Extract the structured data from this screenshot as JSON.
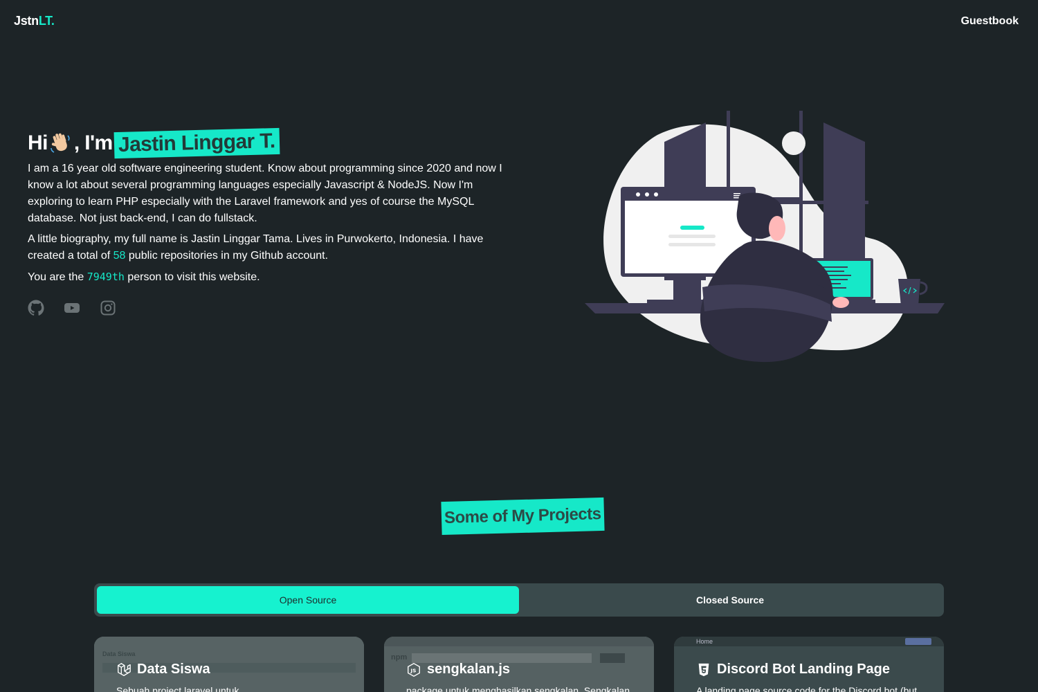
{
  "nav": {
    "logo_main": "Jstn",
    "logo_accent": "LT.",
    "guestbook": "Guestbook"
  },
  "hero": {
    "greeting_hi": "Hi",
    "greeting_im": ", I'm",
    "name": "Jastin Linggar T.",
    "para1": "I am a 16 year old software engineering student. Know about programming since 2020 and now I know a lot about several programming languages especially Javascript & NodeJS. Now I'm exploring to learn PHP especially with the Laravel framework and yes of course the MySQL database. Not just back-end, I can do fullstack.",
    "para2_before": "A little biography, my full name is Jastin Linggar Tama. Lives in Purwokerto, Indonesia. I have created a total of",
    "repo_count": "58",
    "para2_after": "public repositories in my Github account.",
    "visit_before": "You are the",
    "visit_count": "7949th",
    "visit_after": "person to visit this website."
  },
  "socials": [
    "github-icon",
    "youtube-icon",
    "instagram-icon"
  ],
  "projects": {
    "title": "Some of My Projects",
    "tabs": [
      {
        "label": "Open Source",
        "active": true
      },
      {
        "label": "Closed Source",
        "active": false
      }
    ],
    "cards": [
      {
        "title": "Data Siswa",
        "desc": "Sebuah project laravel untuk",
        "icon": "laravel-icon",
        "mini": "Data Siswa"
      },
      {
        "title": "sengkalan.js",
        "desc": "package untuk menghasilkan sengkalan. Sengkalan",
        "icon": "nodejs-icon",
        "mini": "npm"
      },
      {
        "title": "Discord Bot Landing Page",
        "desc": "A landing page source code for the Discord bot (but",
        "icon": "html5-icon",
        "mini": "Home"
      }
    ]
  },
  "colors": {
    "accent": "#16e8c8",
    "background": "#1d2427",
    "tab_bg": "#3a4a4c"
  }
}
